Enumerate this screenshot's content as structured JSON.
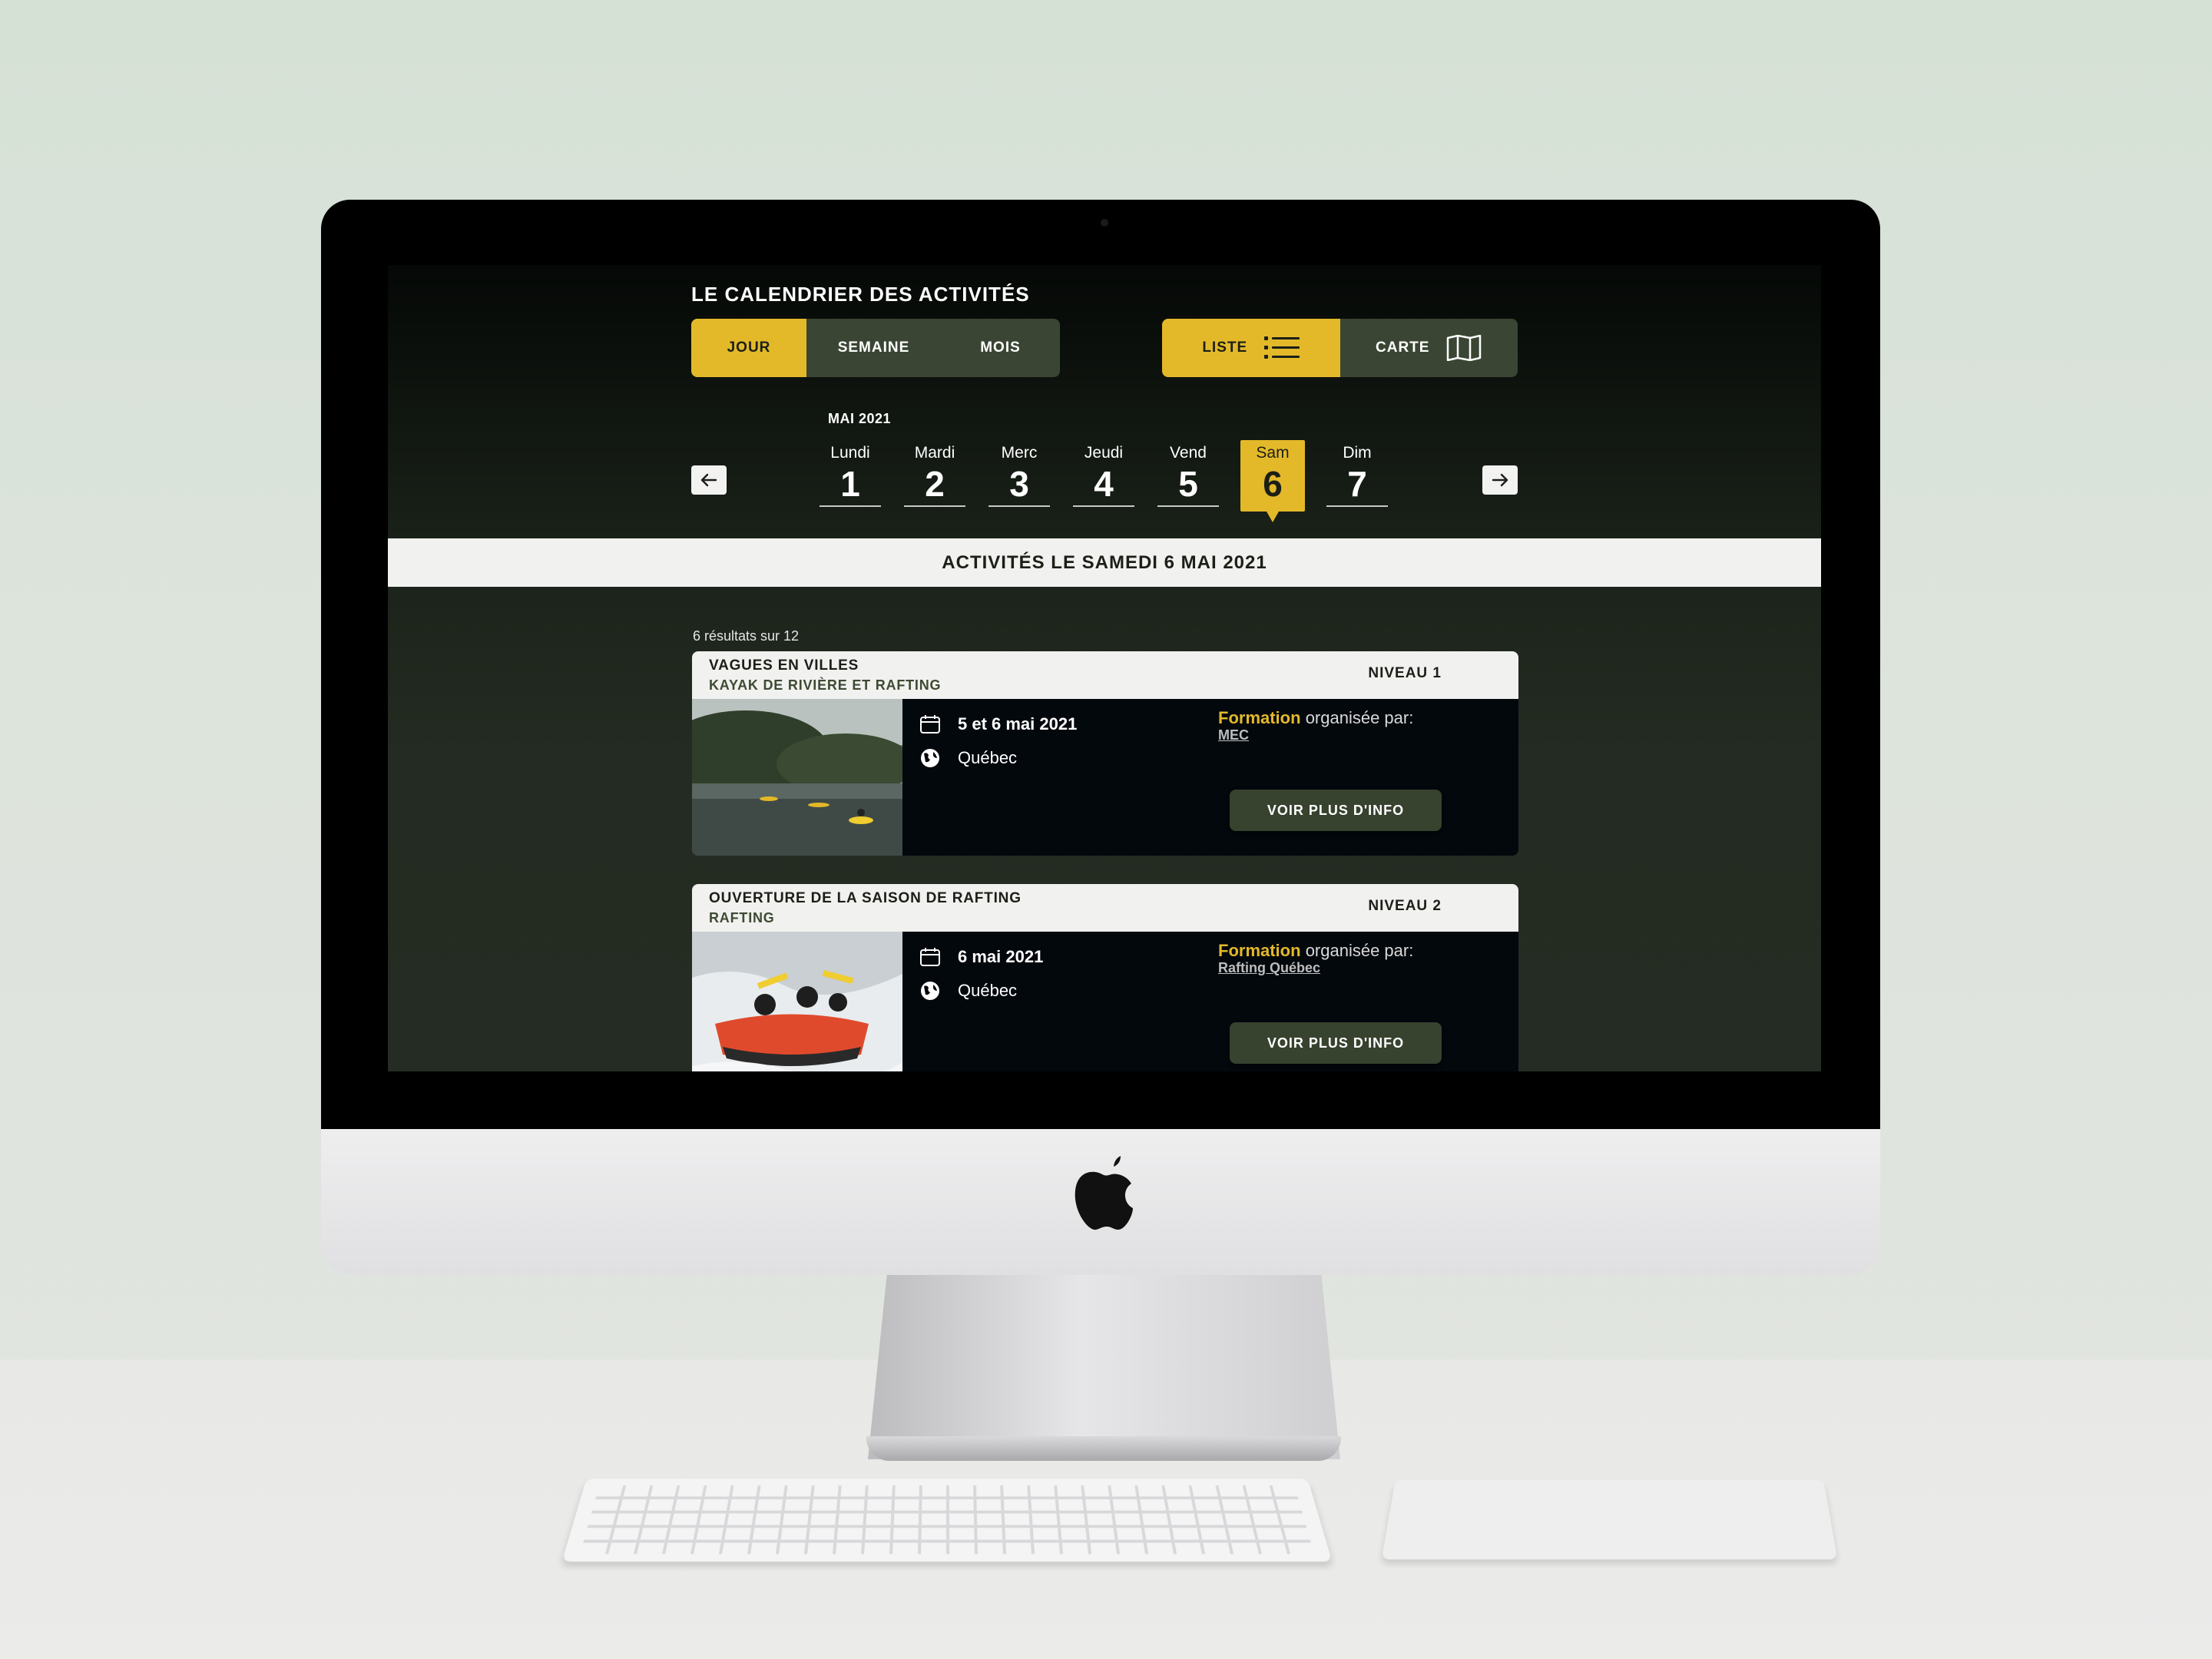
{
  "page_title": "LE CALENDRIER DES ACTIVITÉS",
  "view_tabs": [
    {
      "label": "JOUR",
      "active": true
    },
    {
      "label": "SEMAINE",
      "active": false
    },
    {
      "label": "MOIS",
      "active": false
    }
  ],
  "mode_tabs": [
    {
      "label": "LISTE",
      "icon": "list-icon",
      "active": true
    },
    {
      "label": "CARTE",
      "icon": "map-icon",
      "active": false
    }
  ],
  "calendar": {
    "month": "MAI 2021",
    "days": [
      {
        "name": "Lundi",
        "num": "1"
      },
      {
        "name": "Mardi",
        "num": "2"
      },
      {
        "name": "Merc",
        "num": "3"
      },
      {
        "name": "Jeudi",
        "num": "4"
      },
      {
        "name": "Vend",
        "num": "5"
      },
      {
        "name": "Sam",
        "num": "6"
      },
      {
        "name": "Dim",
        "num": "7"
      }
    ],
    "selected_day": "6"
  },
  "banner": "ACTIVITÉS LE SAMEDI 6 MAI 2021",
  "results_text": "6 résultats sur 12",
  "activities": [
    {
      "title": "VAGUES EN VILLES",
      "subtitle": "KAYAK DE RIVIÈRE ET RAFTING",
      "level": "NIVEAU 1",
      "date": "5 et 6 mai 2021",
      "place": "Québec",
      "org_keyword": "Formation",
      "org_text": "organisée par:",
      "org_name": "MEC",
      "button": "VOIR PLUS D'INFO"
    },
    {
      "title": "OUVERTURE DE LA SAISON DE RAFTING",
      "subtitle": "RAFTING",
      "level": "NIVEAU 2",
      "date": "6 mai 2021",
      "place": "Québec",
      "org_keyword": "Formation",
      "org_text": "organisée par:",
      "org_name": "Rafting Québec",
      "button": "VOIR PLUS D'INFO"
    }
  ],
  "colors": {
    "accent": "#e3b929",
    "panel": "#3a4633",
    "background": "#232b22",
    "card": "#03080d"
  }
}
